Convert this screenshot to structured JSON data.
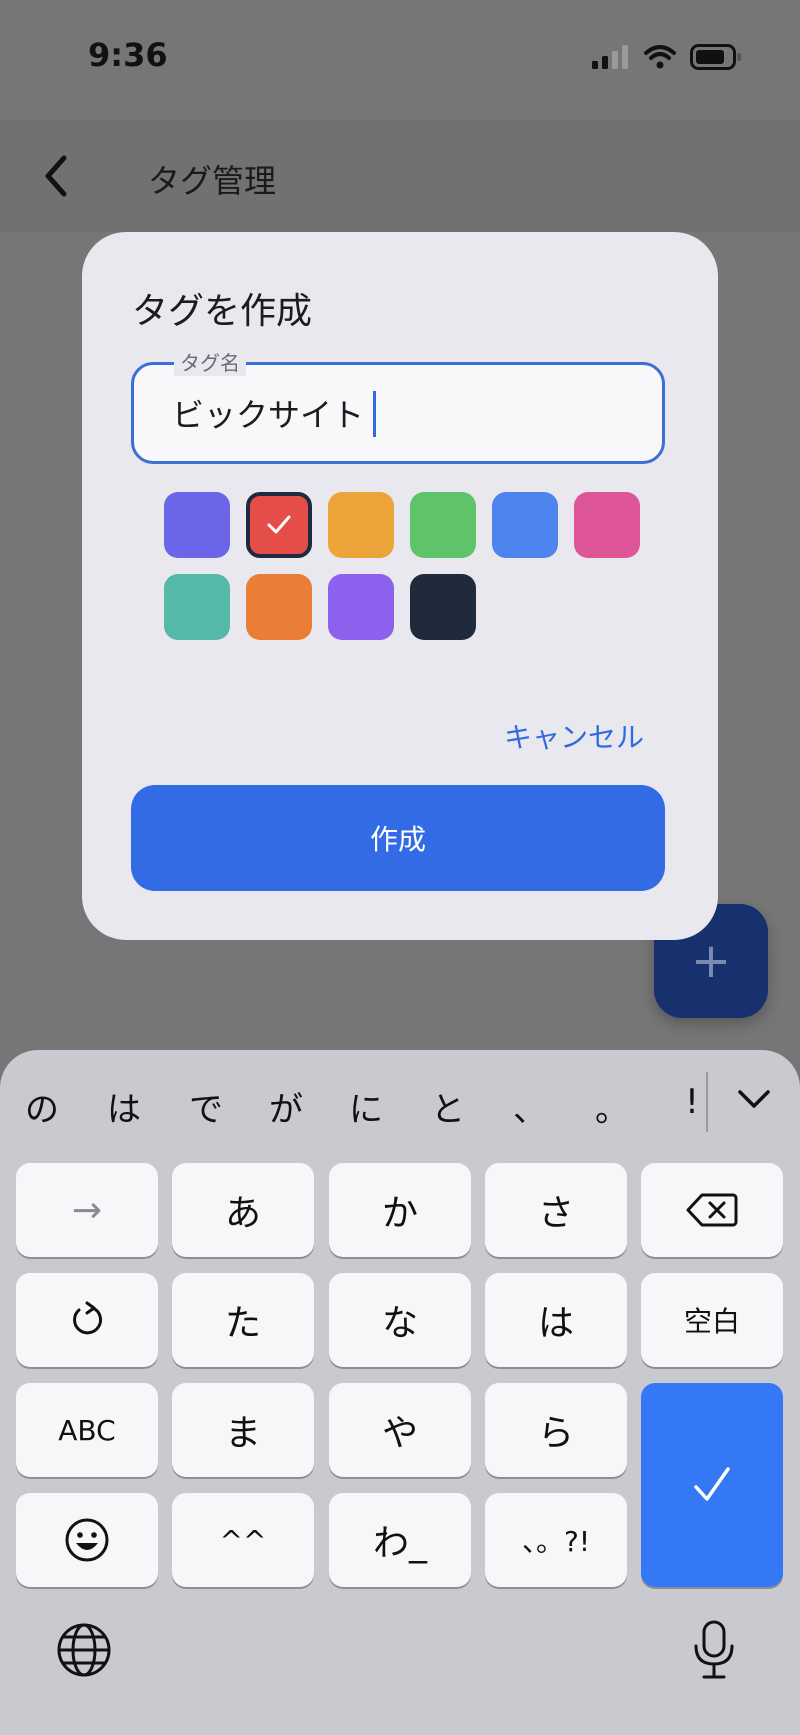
{
  "status": {
    "time": "9:36"
  },
  "nav": {
    "title": "タグ管理"
  },
  "dialog": {
    "title": "タグを作成",
    "field_label": "タグ名",
    "field_value": "ビックサイト",
    "swatch_colors": [
      "#6b65e8",
      "#e44d48",
      "#eca43a",
      "#5fc36a",
      "#4d85ef",
      "#de5598",
      "#55b9a8",
      "#eb7e36",
      "#8b61ee",
      "#1f2a3d"
    ],
    "selected_color": "#e44d48",
    "cancel_label": "キャンセル",
    "create_label": "作成"
  },
  "fab": {
    "label": "+"
  },
  "keyboard": {
    "candidates": [
      "の",
      "は",
      "で",
      "が",
      "に",
      "と",
      "、",
      "。",
      "!"
    ],
    "rows": [
      [
        "→",
        "あ",
        "か",
        "さ"
      ],
      [
        "↺",
        "た",
        "な",
        "は",
        "空白"
      ],
      [
        "ABC",
        "ま",
        "や",
        "ら"
      ],
      [
        "☺",
        "^^",
        "わ_",
        "、。?!"
      ]
    ],
    "enter_icon": "checkmark-icon",
    "left_bottom_icon": "globe-icon",
    "right_bottom_icon": "microphone-icon"
  },
  "colors": {
    "accent": "#336be6",
    "enter": "#3478f6",
    "fab": "#17306e"
  }
}
